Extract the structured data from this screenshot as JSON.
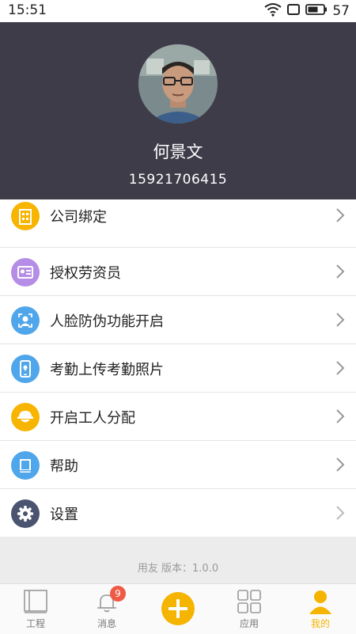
{
  "status_bar": {
    "time": "15:51",
    "battery": "57"
  },
  "profile": {
    "name": "何景文",
    "phone": "15921706415"
  },
  "menu": {
    "items": [
      {
        "label": "公司绑定",
        "icon": "building-icon",
        "color": "#f7b400"
      },
      {
        "label": "授权劳资员",
        "icon": "id-card-icon",
        "color": "#b58ce6"
      },
      {
        "label": "人脸防伪功能开启",
        "icon": "face-scan-icon",
        "color": "#4fa6ea"
      },
      {
        "label": "考勤上传考勤照片",
        "icon": "phone-location-icon",
        "color": "#4fa6ea"
      },
      {
        "label": "开启工人分配",
        "icon": "worker-helmet-icon",
        "color": "#f7b400"
      },
      {
        "label": "帮助",
        "icon": "book-icon",
        "color": "#4fa6ea"
      },
      {
        "label": "设置",
        "icon": "gear-icon",
        "color": "#4a5470"
      }
    ]
  },
  "footer": {
    "version": "用友  版本：1.0.0"
  },
  "tabbar": {
    "tabs": [
      {
        "label": "工程",
        "icon": "project-icon"
      },
      {
        "label": "消息",
        "icon": "bell-icon",
        "badge": "9"
      },
      {
        "label": "",
        "icon": "add-icon"
      },
      {
        "label": "应用",
        "icon": "apps-grid-icon"
      },
      {
        "label": "我的",
        "icon": "person-icon",
        "active": true
      }
    ]
  },
  "colors": {
    "accent": "#f5b400",
    "header_bg": "#3f3c4a",
    "badge": "#ee5a45"
  }
}
